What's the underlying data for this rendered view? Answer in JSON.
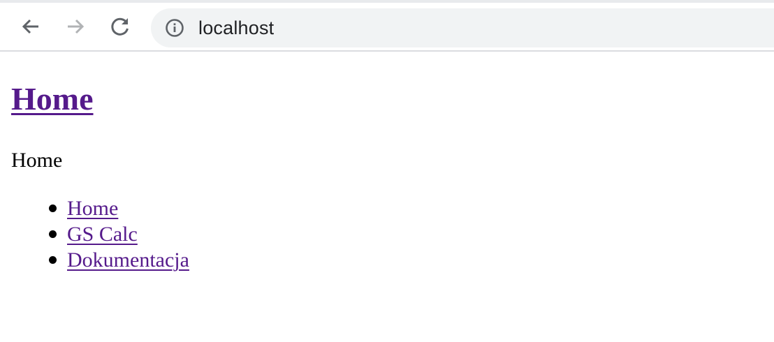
{
  "browser": {
    "url": "localhost",
    "icons": {
      "back": "arrow-left-icon",
      "forward": "arrow-right-icon",
      "reload": "reload-icon",
      "site_info": "info-icon"
    },
    "colors": {
      "toolbar_bg": "#ffffff",
      "omnibox_bg": "#f1f3f4",
      "icon_active": "#5f6368",
      "icon_disabled": "#b1b3b5"
    }
  },
  "page": {
    "title": "Home",
    "text": "Home",
    "nav": [
      {
        "label": "Home"
      },
      {
        "label": "GS Calc"
      },
      {
        "label": "Dokumentacja"
      }
    ],
    "colors": {
      "link_visited": "#551a8b",
      "text": "#000000"
    }
  }
}
